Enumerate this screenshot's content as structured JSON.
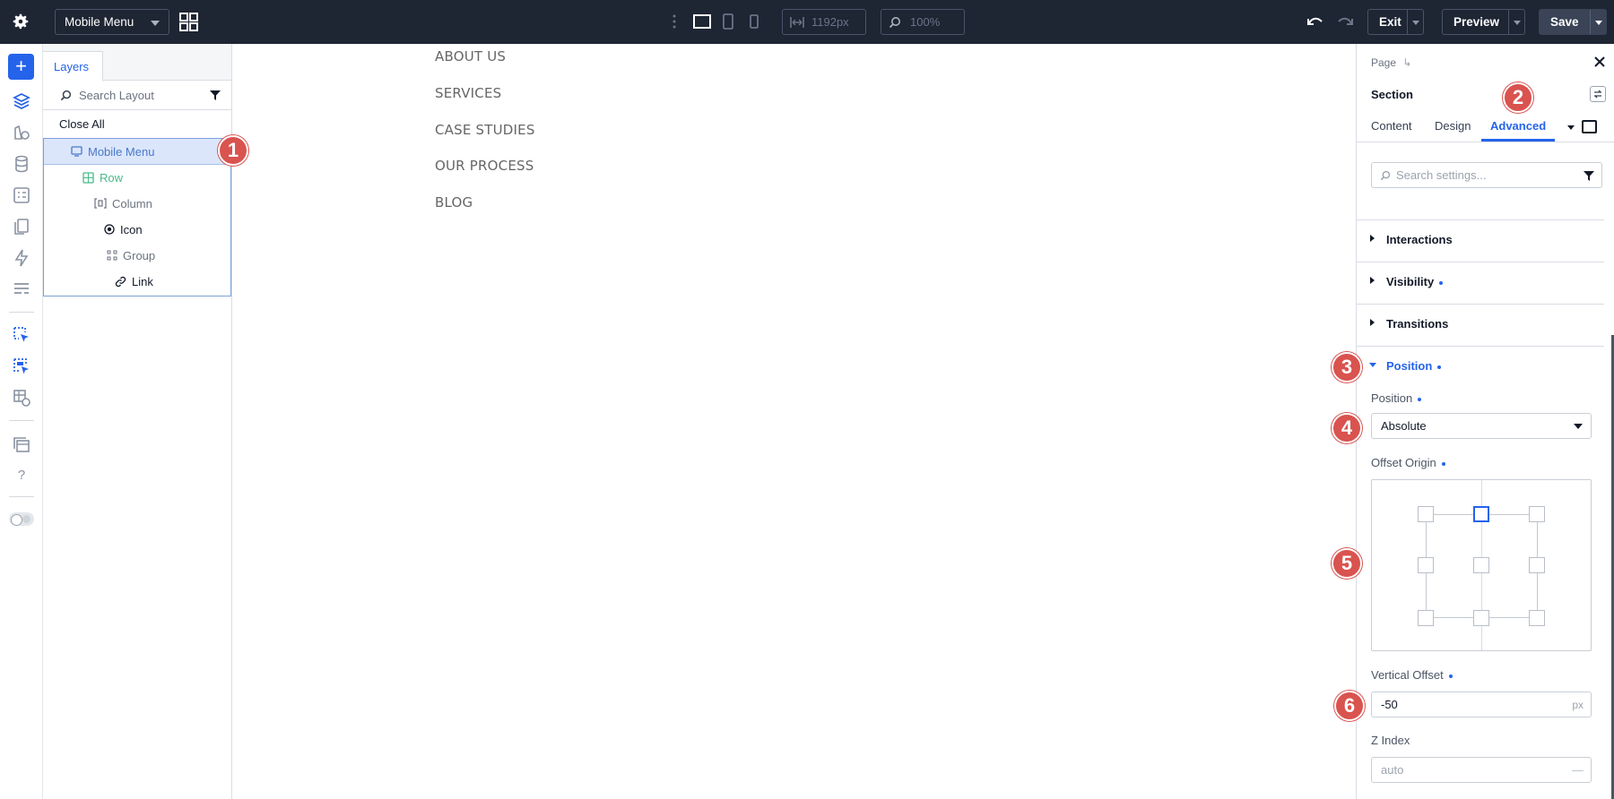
{
  "topbar": {
    "layout_select": "Mobile Menu",
    "width_field": "1192px",
    "zoom_field": "100%",
    "exit_label": "Exit",
    "preview_label": "Preview",
    "save_label": "Save"
  },
  "layers": {
    "tab_label": "Layers",
    "search_placeholder": "Search Layout",
    "close_all_label": "Close All",
    "items": [
      {
        "label": "Mobile Menu",
        "icon": "monitor-icon",
        "color": "#4a78c9"
      },
      {
        "label": "Row",
        "icon": "row-icon",
        "color": "#4ab98a"
      },
      {
        "label": "Column",
        "icon": "column-icon",
        "color": "#6b7280"
      },
      {
        "label": "Icon",
        "icon": "circle-dot-icon",
        "color": "#111827"
      },
      {
        "label": "Group",
        "icon": "group-icon",
        "color": "#6b7280"
      },
      {
        "label": "Link",
        "icon": "link-icon",
        "color": "#111827"
      }
    ]
  },
  "canvas": {
    "nav_items": [
      "ABOUT US",
      "SERVICES",
      "CASE STUDIES",
      "OUR PROCESS",
      "BLOG"
    ]
  },
  "settings": {
    "breadcrumb": "Page",
    "title": "Section",
    "tabs": [
      "Content",
      "Design",
      "Advanced"
    ],
    "active_tab": "Advanced",
    "search_placeholder": "Search settings...",
    "sections": {
      "interactions": "Interactions",
      "visibility": "Visibility",
      "transitions": "Transitions",
      "position": "Position"
    },
    "position_label": "Position",
    "position_value": "Absolute",
    "offset_origin_label": "Offset Origin",
    "offset_origin_selected": "top-center",
    "vertical_offset_label": "Vertical Offset",
    "vertical_offset_value": "-50",
    "vertical_offset_unit": "px",
    "z_index_label": "Z Index",
    "z_index_placeholder": "auto",
    "z_index_dash": "—"
  },
  "markers": [
    "1",
    "2",
    "3",
    "4",
    "5",
    "6"
  ],
  "colors": {
    "topbar_bg": "#1e2533",
    "accent": "#2563eb",
    "marker": "#d9534f"
  }
}
